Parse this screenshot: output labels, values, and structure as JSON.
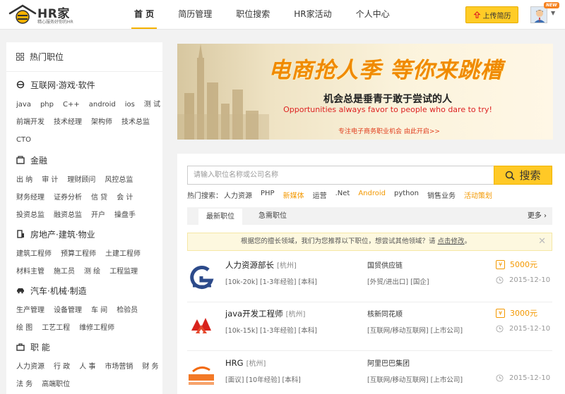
{
  "header": {
    "logo_text": "HR家",
    "logo_sub": "精心服务好你的HR",
    "nav": [
      "首 页",
      "简历管理",
      "职位搜索",
      "HR家活动",
      "个人中心"
    ],
    "upload_label": "上传简历",
    "new_badge": "NEW"
  },
  "sidebar": {
    "title": "热门职位",
    "categories": [
      {
        "name": "互联网·游戏·软件",
        "icon": "internet-icon",
        "tags": [
          "java",
          "php",
          "C++",
          "android",
          "ios",
          "测 试",
          "前端开发",
          "技术经理",
          "架构师",
          "技术总监",
          "CTO"
        ]
      },
      {
        "name": "金融",
        "icon": "finance-icon",
        "tags": [
          "出 纳",
          "审 计",
          "理财顾问",
          "风控总监",
          "财务经理",
          "证券分析",
          "信 贷",
          "会 计",
          "投资总监",
          "融资总监",
          "开户",
          "操盘手"
        ]
      },
      {
        "name": "房地产·建筑·物业",
        "icon": "building-icon",
        "tags": [
          "建筑工程师",
          "预算工程师",
          "土建工程师",
          "材料主管",
          "施工员",
          "测 绘",
          "工程监理"
        ]
      },
      {
        "name": "汽车·机械·制造",
        "icon": "car-icon",
        "tags": [
          "生产管理",
          "设备管理",
          "车 间",
          "检验员",
          "绘 图",
          "工艺工程",
          "维修工程师"
        ]
      },
      {
        "name": "职 能",
        "icon": "briefcase-icon",
        "tags": [
          "人力资源",
          "行 政",
          "人 事",
          "市场营销",
          "财 务",
          "法 务",
          "高端职位"
        ]
      }
    ]
  },
  "banner": {
    "title": "电商抢人季 等你来跳槽",
    "subtitle": "机会总是垂青于敢于尝试的人",
    "english": "Opportunities always favor to people who dare to try!",
    "link": "专注电子商务职业机会  由此开启>>"
  },
  "search": {
    "placeholder": "请输入职位名称或公司名称",
    "button_label": "搜索",
    "hot_label": "热门搜索：",
    "hot_keywords": [
      {
        "text": "人力资源",
        "color": "#444444"
      },
      {
        "text": "PHP",
        "color": "#444444"
      },
      {
        "text": "新媒体",
        "color": "#f39800"
      },
      {
        "text": "运营",
        "color": "#444444"
      },
      {
        "text": ".Net",
        "color": "#444444"
      },
      {
        "text": "Android",
        "color": "#f39800"
      },
      {
        "text": "python",
        "color": "#444444"
      },
      {
        "text": "销售业务",
        "color": "#444444"
      },
      {
        "text": "活动策划",
        "color": "#f39800"
      }
    ]
  },
  "tabs": {
    "latest": "最新职位",
    "urgent": "急需职位",
    "more": "更多"
  },
  "notice": {
    "text": "根据您的擅长领域，我们为您推荐以下职位，想尝试其他领域？请",
    "link": "点击修改",
    "suffix": "。",
    "close": "✕"
  },
  "jobs": [
    {
      "title": "人力资源部长",
      "city": "[杭州]",
      "meta": "[10k-20k] [1-3年经验] [本科]",
      "company": "国贸供应链",
      "industry": "[外贸/进出口] [国企]",
      "salary": "5000元",
      "date": "2015-12-10",
      "logo": "guomao-logo"
    },
    {
      "title": "java开发工程师",
      "city": "[杭州]",
      "meta": "[10k-15k] [1-3年经验] [本科]",
      "company": "核新同花顺",
      "industry": "[互联网/移动互联网] [上市公司]",
      "salary": "3000元",
      "date": "2015-12-10",
      "logo": "tonghuashun-logo"
    },
    {
      "title": "HRG",
      "city": "[杭州]",
      "meta": "[面议] [10年经验] [本科]",
      "company": "阿里巴巴集团",
      "industry": "[互联网/移动互联网] [上市公司]",
      "salary": "",
      "date": "2015-12-10",
      "logo": "alibaba-logo"
    }
  ],
  "colors": {
    "accent": "#ffc926",
    "salary": "#f39800",
    "banner_title": "#f08a00"
  }
}
